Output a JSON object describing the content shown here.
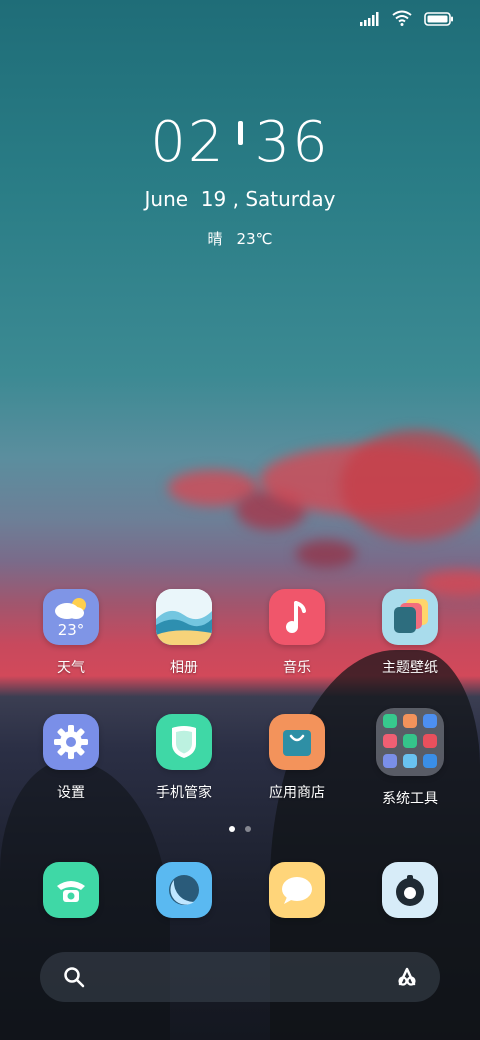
{
  "status_bar": {
    "signal_icon": "signal-icon",
    "wifi_icon": "wifi-icon",
    "battery_icon": "battery-icon"
  },
  "clock": {
    "hours": "02",
    "minutes": "36"
  },
  "date": "June  19 , Saturday",
  "weather": {
    "condition": "晴",
    "temperature": "23℃"
  },
  "apps_row1": [
    {
      "label": "天气",
      "badge": "23°",
      "icon": "weather-icon",
      "color": "#7f95e6"
    },
    {
      "label": "相册",
      "icon": "gallery-icon",
      "color": "#74c6e0"
    },
    {
      "label": "音乐",
      "icon": "music-icon",
      "color": "#f0566b"
    },
    {
      "label": "主题壁纸",
      "icon": "themes-icon",
      "color": "#a9dcec"
    }
  ],
  "apps_row2": [
    {
      "label": "设置",
      "icon": "settings-icon",
      "color": "#7a8fe8"
    },
    {
      "label": "手机管家",
      "icon": "security-icon",
      "color": "#3fd8a6"
    },
    {
      "label": "应用商店",
      "icon": "app-store-icon",
      "color": "#f3935b"
    },
    {
      "label": "系统工具",
      "icon": "folder-icon",
      "color": "#b9c0cb"
    }
  ],
  "dock": [
    {
      "name": "phone",
      "icon": "phone-icon",
      "color": "#3fd8a6"
    },
    {
      "name": "browser",
      "icon": "browser-icon",
      "color": "#5ab9f1"
    },
    {
      "name": "messages",
      "icon": "messages-icon",
      "color": "#ffd57a"
    },
    {
      "name": "camera",
      "icon": "camera-icon",
      "color": "#d7ecf8"
    }
  ],
  "page_indicator": {
    "current": 1,
    "total": 2
  },
  "search": {
    "left_icon": "search-icon",
    "right_icon": "assistant-icon"
  }
}
